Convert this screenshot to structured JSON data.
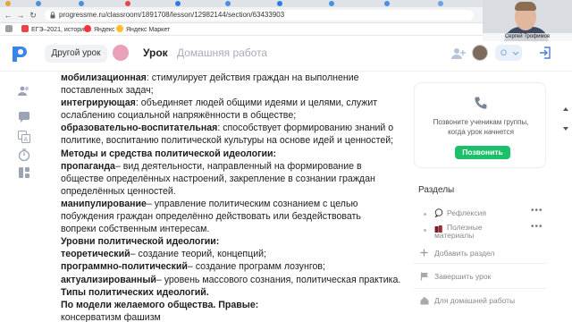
{
  "browser": {
    "url": "progressme.ru/classroom/1891708/lesson/12982144/section/63433903",
    "bookmarks": [
      {
        "label": "ЕГЭ–2021, историк...",
        "color": "#e64646"
      },
      {
        "label": "Яндекс",
        "color": "#f33"
      },
      {
        "label": "Яндекс Маркет",
        "color": "#fbc02d"
      }
    ]
  },
  "webcam": {
    "caption": "Сергей Трофимов"
  },
  "header": {
    "other_lesson_label": "Другой урок",
    "tab_lesson": "Урок",
    "tab_homework": "Домашняя работа",
    "status_label": "О"
  },
  "document": {
    "lines": [
      {
        "bold": "мобилизационная",
        "rest": ": стимулирует действия граждан на выполнение"
      },
      {
        "bold": "",
        "rest": "поставленных задач;"
      },
      {
        "bold": "интегрирующая",
        "rest": ": объединяет людей общими идеями и целями, служит"
      },
      {
        "bold": "",
        "rest": "ослаблению социальной напряжённости в обществе;"
      },
      {
        "bold": "образовательно-воспитательная",
        "rest": ": способствует формированию знаний о"
      },
      {
        "bold": "",
        "rest": "политике, воспитанию политической культуры на основе идей и ценностей;"
      },
      {
        "bold": "Методы и средства политической идеологии:",
        "rest": ""
      },
      {
        "bold": "пропаганда",
        "rest": "– вид деятельности, направленный на формирование в"
      },
      {
        "bold": "",
        "rest": "обществе определённых настроений, закрепление в сознании граждан"
      },
      {
        "bold": "",
        "rest": "определённых ценностей."
      },
      {
        "bold": "манипулирование",
        "rest": "– управление политическим сознанием с целью"
      },
      {
        "bold": "",
        "rest": "побуждения граждан определённо действовать или бездействовать"
      },
      {
        "bold": "",
        "rest": "вопреки собственным интересам."
      },
      {
        "bold": "Уровни политической идеологии:",
        "rest": ""
      },
      {
        "bold": "теоретический",
        "rest": "– создание теорий, концепций;"
      },
      {
        "bold": "программно-политический",
        "rest": "– создание программ лозунгов;"
      },
      {
        "bold": "актуализированный",
        "rest": "– уровень массового сознания, политическая практика."
      },
      {
        "bold": "Типы политических идеологий.",
        "rest": ""
      },
      {
        "bold": "По модели желаемого общества. Правые:",
        "rest": ""
      },
      {
        "bold": "",
        "rest": "консерватизм фашизм"
      }
    ]
  },
  "call_card": {
    "text_line1": "Позвоните ученикам группы,",
    "text_line2": "когда урок начнется",
    "button_label": "Позвонить"
  },
  "sections": {
    "title": "Разделы",
    "items": [
      {
        "label": "Рефлексия",
        "icon": "speech-bubble-icon"
      },
      {
        "label": "Полезные материалы",
        "icon": "books-icon"
      }
    ],
    "add_label": "Добавить раздел"
  },
  "actions": {
    "finish_lesson": "Завершить урок",
    "for_homework": "Для домашней работы"
  },
  "colors": {
    "accent_green": "#1cc06b",
    "accent_blue": "#4a90e2"
  }
}
